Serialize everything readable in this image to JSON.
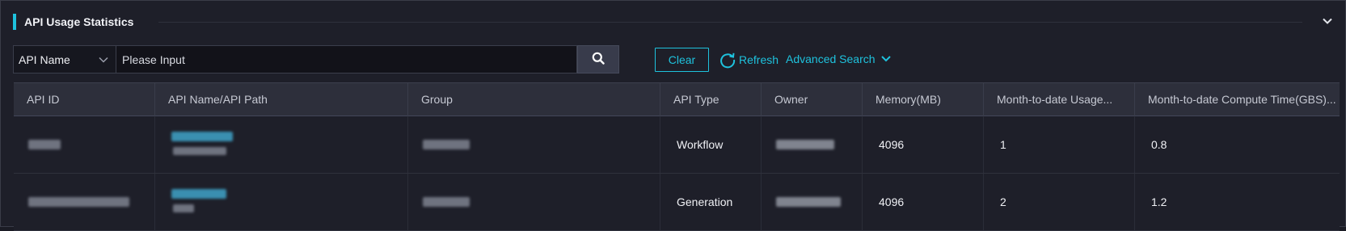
{
  "section": {
    "title": "API Usage Statistics",
    "collapse_icon": "chevron-down-icon"
  },
  "search": {
    "field_select": "API Name",
    "placeholder": "Please Input",
    "search_icon": "search-icon",
    "clear_label": "Clear",
    "refresh_label": "Refresh",
    "advanced_label": "Advanced Search"
  },
  "colors": {
    "accent": "#1ec2dd",
    "background": "#1e1f29",
    "header_bg": "#2d2f3b"
  },
  "table": {
    "columns": [
      "API ID",
      "API Name/API Path",
      "Group",
      "API Type",
      "Owner",
      "Memory(MB)",
      "Month-to-date Usage...",
      "Month-to-date Compute Time(GBS)..."
    ],
    "rows": [
      {
        "api_type": "Workflow",
        "memory": "4096",
        "usage": "1",
        "compute": "0.8"
      },
      {
        "api_type": "Generation",
        "memory": "4096",
        "usage": "2",
        "compute": "1.2"
      }
    ]
  }
}
